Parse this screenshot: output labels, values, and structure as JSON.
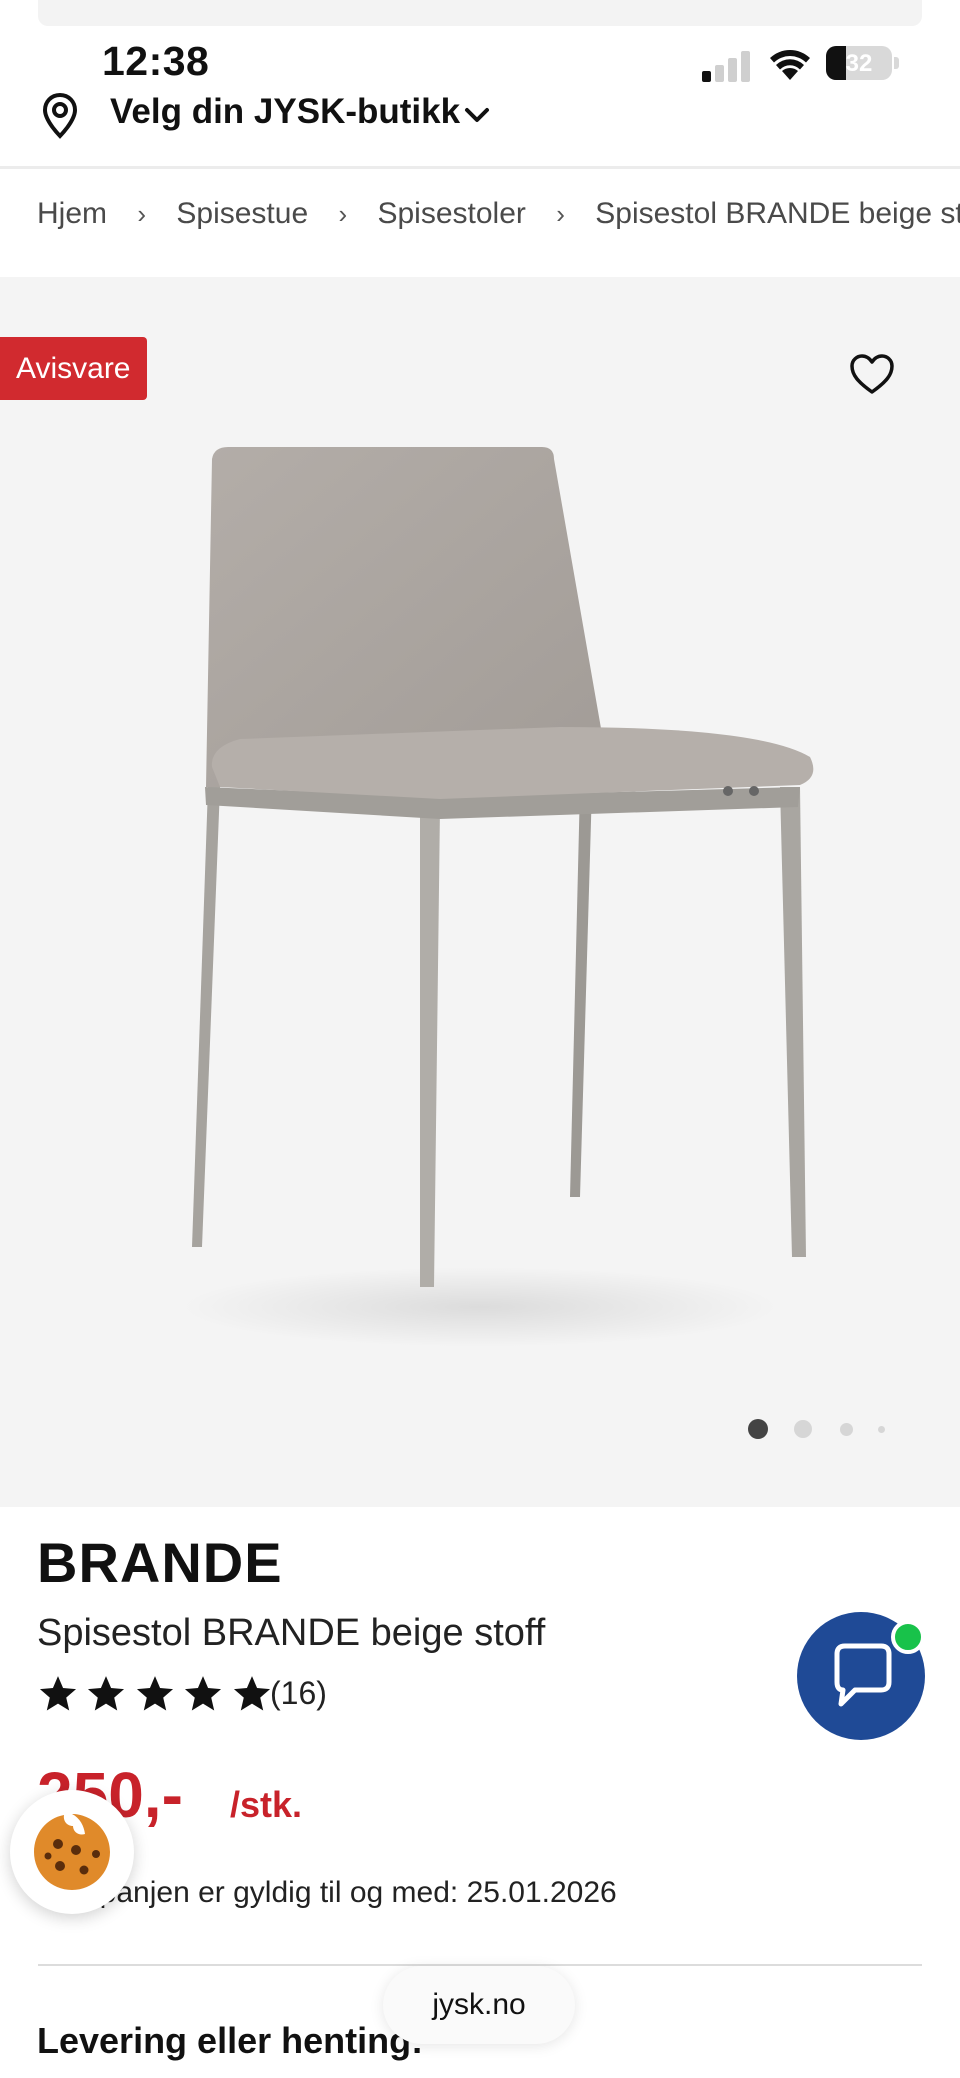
{
  "status_bar": {
    "time": "12:38",
    "battery": "32"
  },
  "store_selector": {
    "label": "Velg din JYSK-butikk"
  },
  "breadcrumb": [
    "Hjem",
    "Spisestue",
    "Spisestoler",
    "Spisestol BRANDE beige stoff"
  ],
  "gallery": {
    "badge": "Avisvare",
    "image_count": 4,
    "active_image_index": 0
  },
  "product": {
    "brand": "BRANDE",
    "name": "Spisestol BRANDE beige stoff",
    "rating": 5,
    "review_count": "(16)",
    "price": "250,-",
    "unit": "/stk.",
    "campaign_text": "Kampanjen er gyldig til og med: 25.01.2026"
  },
  "sections": {
    "delivery_heading": "Levering eller henting:"
  },
  "browser": {
    "url": "jysk.no"
  },
  "colors": {
    "badge_red": "#d12a2f",
    "price_red": "#c8222a",
    "chat_blue": "#1f4a96",
    "chat_online_green": "#18c24a"
  },
  "icons": {
    "location": "map-pin-icon",
    "chevron": "chevron-down-icon",
    "favorite": "heart-icon",
    "chat": "chat-bubble-icon",
    "cookie": "cookie-icon"
  }
}
